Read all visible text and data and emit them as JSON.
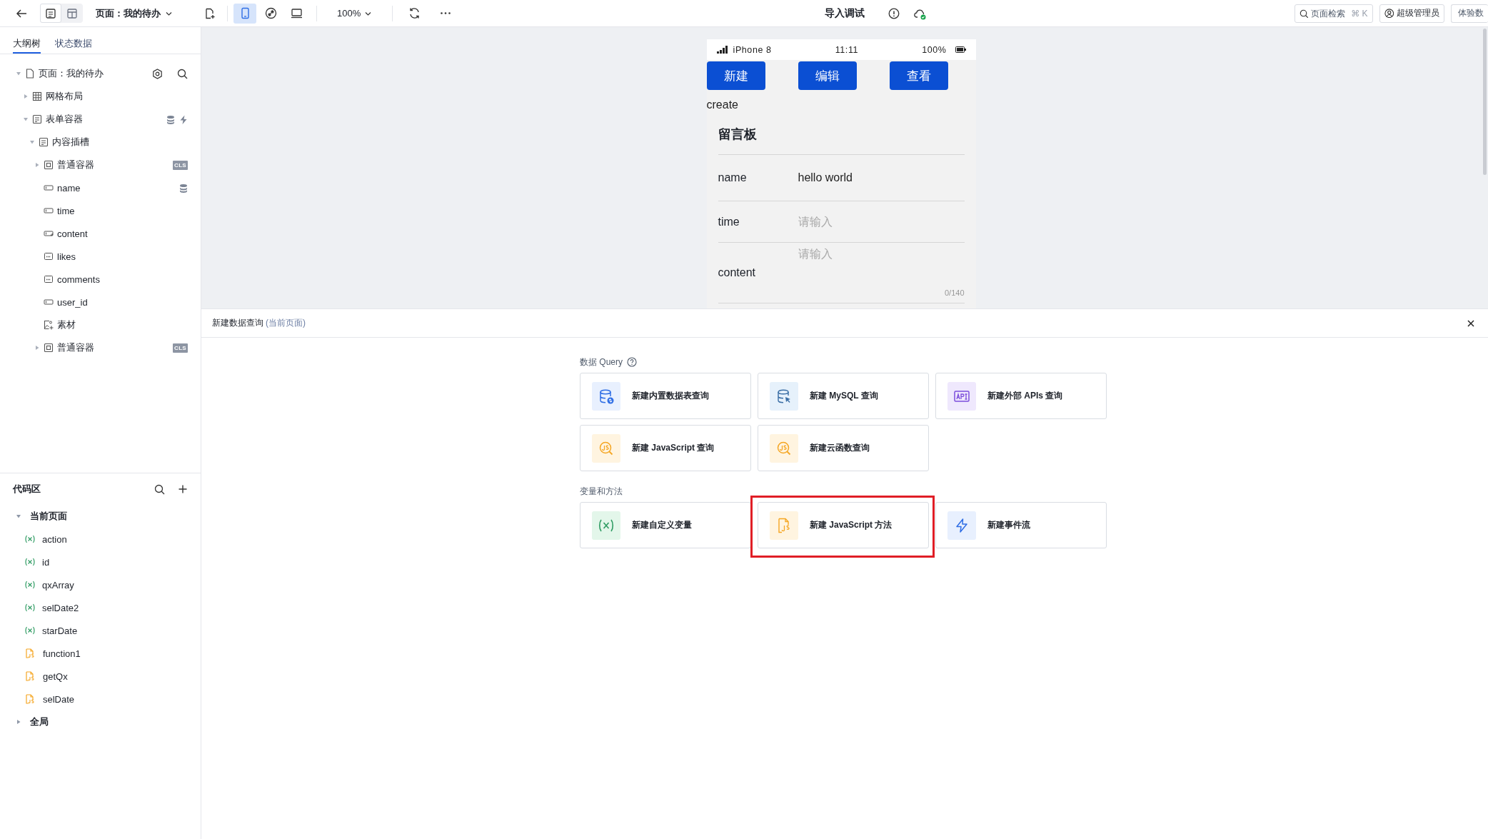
{
  "toolbar": {
    "view_modes": [
      {
        "kind": "outline",
        "selected": true
      },
      {
        "kind": "layout",
        "selected": false
      }
    ],
    "page_selector": "页面：我的待办",
    "devices": [
      {
        "kind": "mobile",
        "selected": true
      },
      {
        "kind": "link",
        "selected": false
      },
      {
        "kind": "desktop",
        "selected": false
      }
    ],
    "zoom": "100%",
    "title": "导入调试",
    "search": {
      "placeholder": "页面检索",
      "shortcut": "⌘ K"
    },
    "user": "超级管理员",
    "trial_button": "体验数"
  },
  "sidebar": {
    "tabs": [
      {
        "label": "大纲树",
        "selected": true
      },
      {
        "label": "状态数据",
        "selected": false
      }
    ],
    "outline": [
      {
        "label": "页面：我的待办",
        "kind": "page",
        "expanded": true,
        "tags": [
          {
            "kind": "settings"
          },
          {
            "kind": "search"
          }
        ],
        "children": [
          {
            "label": "网格布局",
            "kind": "grid",
            "expanded": false
          },
          {
            "label": "表单容器",
            "kind": "form",
            "expanded": true,
            "tags": [
              {
                "kind": "data"
              },
              {
                "kind": "event"
              }
            ],
            "children": [
              {
                "label": "内容插槽",
                "kind": "form",
                "expanded": true,
                "children": [
                  {
                    "label": "普通容器",
                    "kind": "container",
                    "expanded": false,
                    "tags": [
                      {
                        "kind": "class",
                        "text": "CLS"
                      }
                    ]
                  },
                  {
                    "label": "name",
                    "kind": "input",
                    "tags": [
                      {
                        "kind": "data"
                      }
                    ]
                  },
                  {
                    "label": "time",
                    "kind": "input"
                  },
                  {
                    "label": "content",
                    "kind": "textarea"
                  },
                  {
                    "label": "likes",
                    "kind": "number"
                  },
                  {
                    "label": "comments",
                    "kind": "number"
                  },
                  {
                    "label": "user_id",
                    "kind": "input"
                  },
                  {
                    "label": "素材",
                    "kind": "image"
                  },
                  {
                    "label": "普通容器",
                    "kind": "container",
                    "expanded": false,
                    "tags": [
                      {
                        "kind": "class",
                        "text": "CLS"
                      }
                    ]
                  }
                ]
              }
            ]
          }
        ]
      }
    ]
  },
  "code_area": {
    "title": "代码区",
    "groups": [
      {
        "label": "当前页面",
        "expanded": true,
        "items": [
          {
            "kind": "variable",
            "label": "action"
          },
          {
            "kind": "variable",
            "label": "id"
          },
          {
            "kind": "variable",
            "label": "qxArray"
          },
          {
            "kind": "variable",
            "label": "selDate2"
          },
          {
            "kind": "variable",
            "label": "starDate"
          },
          {
            "kind": "function",
            "label": "function1"
          },
          {
            "kind": "function",
            "label": "getQx"
          },
          {
            "kind": "function",
            "label": "selDate"
          }
        ]
      },
      {
        "label": "全局",
        "expanded": false
      }
    ]
  },
  "phone": {
    "device": "iPhone 8",
    "time": "11:11",
    "battery": "100%",
    "buttons": [
      "新建",
      "编辑",
      "查看"
    ],
    "caption": "create",
    "form": {
      "title": "留言板",
      "fields": [
        {
          "kind": "input",
          "label": "name",
          "value": "hello world"
        },
        {
          "kind": "input",
          "label": "time",
          "placeholder": "请输入"
        },
        {
          "kind": "textarea",
          "label": "content",
          "placeholder": "请输入",
          "counter": "0/140"
        }
      ]
    }
  },
  "panel": {
    "title": "新建数据查询",
    "scope": "(当前页面)",
    "sections": [
      {
        "title": "数据 Query",
        "help": true,
        "cards": [
          {
            "kind": "table",
            "label": "新建内置数据表查询",
            "highlighted": false
          },
          {
            "kind": "mysql",
            "label": "新建 MySQL 查询",
            "highlighted": false
          },
          {
            "kind": "api",
            "label": "新建外部 APIs 查询",
            "highlighted": false
          },
          {
            "kind": "js-query",
            "label": "新建 JavaScript 查询",
            "highlighted": false
          },
          {
            "kind": "js-query",
            "label": "新建云函数查询",
            "highlighted": false
          }
        ]
      },
      {
        "title": "变量和方法",
        "help": false,
        "cards": [
          {
            "kind": "variable",
            "label": "新建自定义变量",
            "highlighted": false
          },
          {
            "kind": "js-file",
            "label": "新建 JavaScript 方法",
            "highlighted": true
          },
          {
            "kind": "bolt",
            "label": "新建事件流",
            "highlighted": false
          }
        ]
      }
    ]
  }
}
